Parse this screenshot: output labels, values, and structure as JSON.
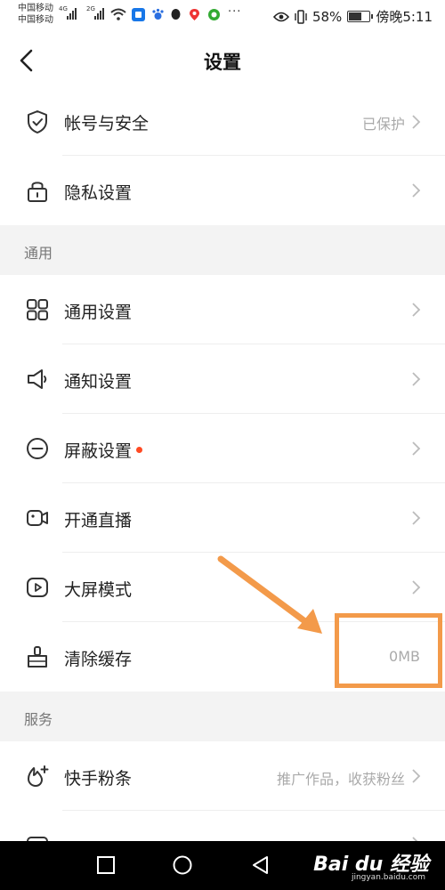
{
  "status_bar": {
    "carrier_1": "中国移动",
    "carrier_2": "中国移动",
    "net_1": "4G",
    "net_2": "2G",
    "battery_percent": "58%",
    "time": "傍晚5:11",
    "more": "···"
  },
  "header": {
    "title": "设置"
  },
  "rows": {
    "account_security": {
      "label": "帐号与安全",
      "value": "已保护",
      "icon": "shield-icon"
    },
    "privacy": {
      "label": "隐私设置",
      "icon": "lock-icon"
    },
    "general": {
      "label": "通用设置",
      "icon": "grid-icon"
    },
    "notification": {
      "label": "通知设置",
      "icon": "speaker-icon"
    },
    "block": {
      "label": "屏蔽设置",
      "icon": "minus-circle-icon"
    },
    "live": {
      "label": "开通直播",
      "icon": "camera-icon"
    },
    "big_screen": {
      "label": "大屏模式",
      "icon": "play-icon"
    },
    "clear_cache": {
      "label": "清除缓存",
      "value": "0MB",
      "icon": "broom-icon"
    },
    "fans": {
      "label": "快手粉条",
      "value": "推广作品，收获粉丝",
      "icon": "fans-icon"
    }
  },
  "sections": {
    "general": "通用",
    "service": "服务"
  },
  "colors": {
    "accent": "#ff4a23",
    "annotation": "#f39a4a"
  },
  "watermark": {
    "text": "Bai du 经验",
    "sub": "jingyan.baidu.com"
  }
}
